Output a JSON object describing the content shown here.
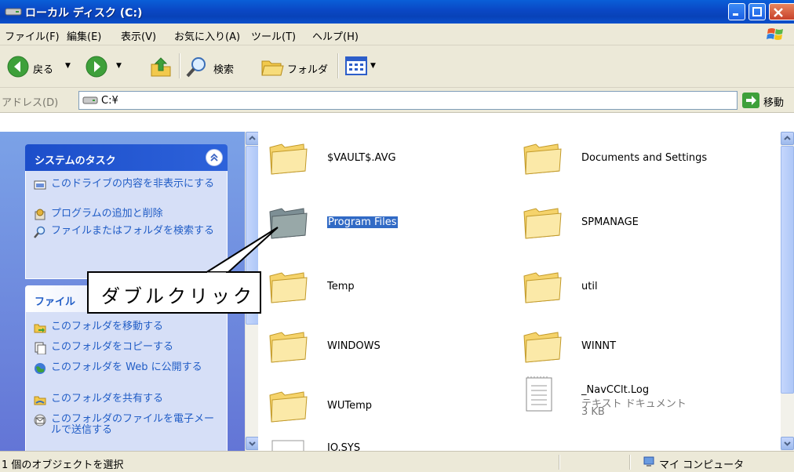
{
  "window": {
    "title": "ローカル ディスク (C:)"
  },
  "menu": [
    "ファイル(F)",
    "編集(E)",
    "表示(V)",
    "お気に入り(A)",
    "ツール(T)",
    "ヘルプ(H)"
  ],
  "toolbar": {
    "back_label": "戻る",
    "search_label": "検索",
    "folders_label": "フォルダ"
  },
  "address": {
    "label": "アドレス(D)",
    "value": "C:¥",
    "go_label": "移動"
  },
  "tasks": {
    "system": {
      "title": "システムのタスク",
      "items": [
        {
          "label": "このドライブの内容を非表示にする",
          "icon": "hide-drive-icon"
        },
        {
          "label": "プログラムの追加と削除",
          "icon": "add-remove-programs-icon"
        },
        {
          "label": "ファイルまたはフォルダを検索する",
          "icon": "search-icon"
        }
      ]
    },
    "file": {
      "title": "ファイル",
      "items": [
        {
          "label": "このフォルダを移動する",
          "icon": "move-folder-icon"
        },
        {
          "label": "このフォルダをコピーする",
          "icon": "copy-folder-icon"
        },
        {
          "label": "このフォルダを Web に公開する",
          "icon": "publish-web-icon"
        },
        {
          "label": "このフォルダを共有する",
          "icon": "share-folder-icon"
        },
        {
          "label": "このフォルダのファイルを電子メールで送信する",
          "icon": "email-icon"
        }
      ]
    }
  },
  "files": [
    {
      "name": "$VAULT$.AVG",
      "icon": "folder-icon"
    },
    {
      "name": "Documents and Settings",
      "icon": "folder-icon"
    },
    {
      "name": "Program Files",
      "icon": "folder-icon",
      "selected": true
    },
    {
      "name": "SPMANAGE",
      "icon": "folder-icon"
    },
    {
      "name": "Temp",
      "icon": "folder-icon"
    },
    {
      "name": "util",
      "icon": "folder-icon"
    },
    {
      "name": "WINDOWS",
      "icon": "folder-icon"
    },
    {
      "name": "WINNT",
      "icon": "folder-icon"
    },
    {
      "name": "WUTemp",
      "icon": "folder-icon"
    },
    {
      "name": "_NavCClt.Log",
      "icon": "text-document-icon",
      "type": "テキスト ドキュメント",
      "size": "3 KB"
    },
    {
      "name": "IO.SYS",
      "icon": "system-file-icon"
    }
  ],
  "status": {
    "text": "1 個のオブジェクトを選択",
    "location": "マイ コンピュータ"
  },
  "callout": {
    "text": "ダブルクリック"
  }
}
